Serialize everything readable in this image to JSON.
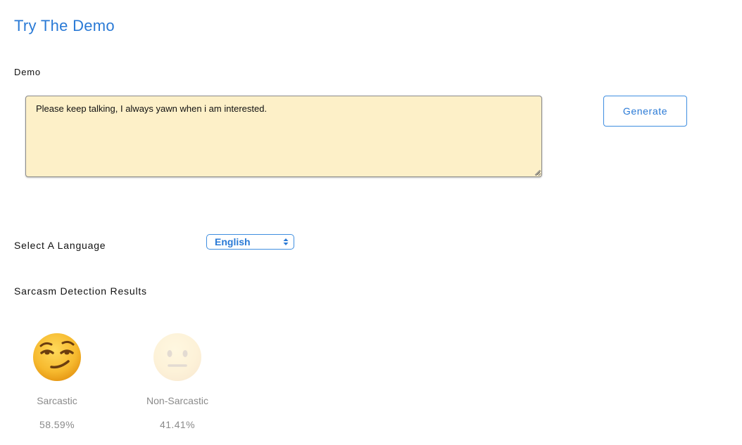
{
  "header": {
    "title": "Try The Demo"
  },
  "demo": {
    "label": "Demo",
    "text": "Please keep talking, I always yawn when i am interested.",
    "generate_label": "Generate"
  },
  "language": {
    "label": "Select A Language",
    "selected": "English"
  },
  "results": {
    "label": "Sarcasm Detection Results",
    "items": [
      {
        "label": "Sarcastic",
        "percent": "58.59%",
        "icon": "smirking-face-icon"
      },
      {
        "label": "Non-Sarcastic",
        "percent": "41.41%",
        "icon": "neutral-face-icon"
      }
    ]
  },
  "colors": {
    "accent": "#2a7ad6",
    "textarea_bg": "#fdf0c8",
    "emoji_yellow": "#f7c33a"
  }
}
